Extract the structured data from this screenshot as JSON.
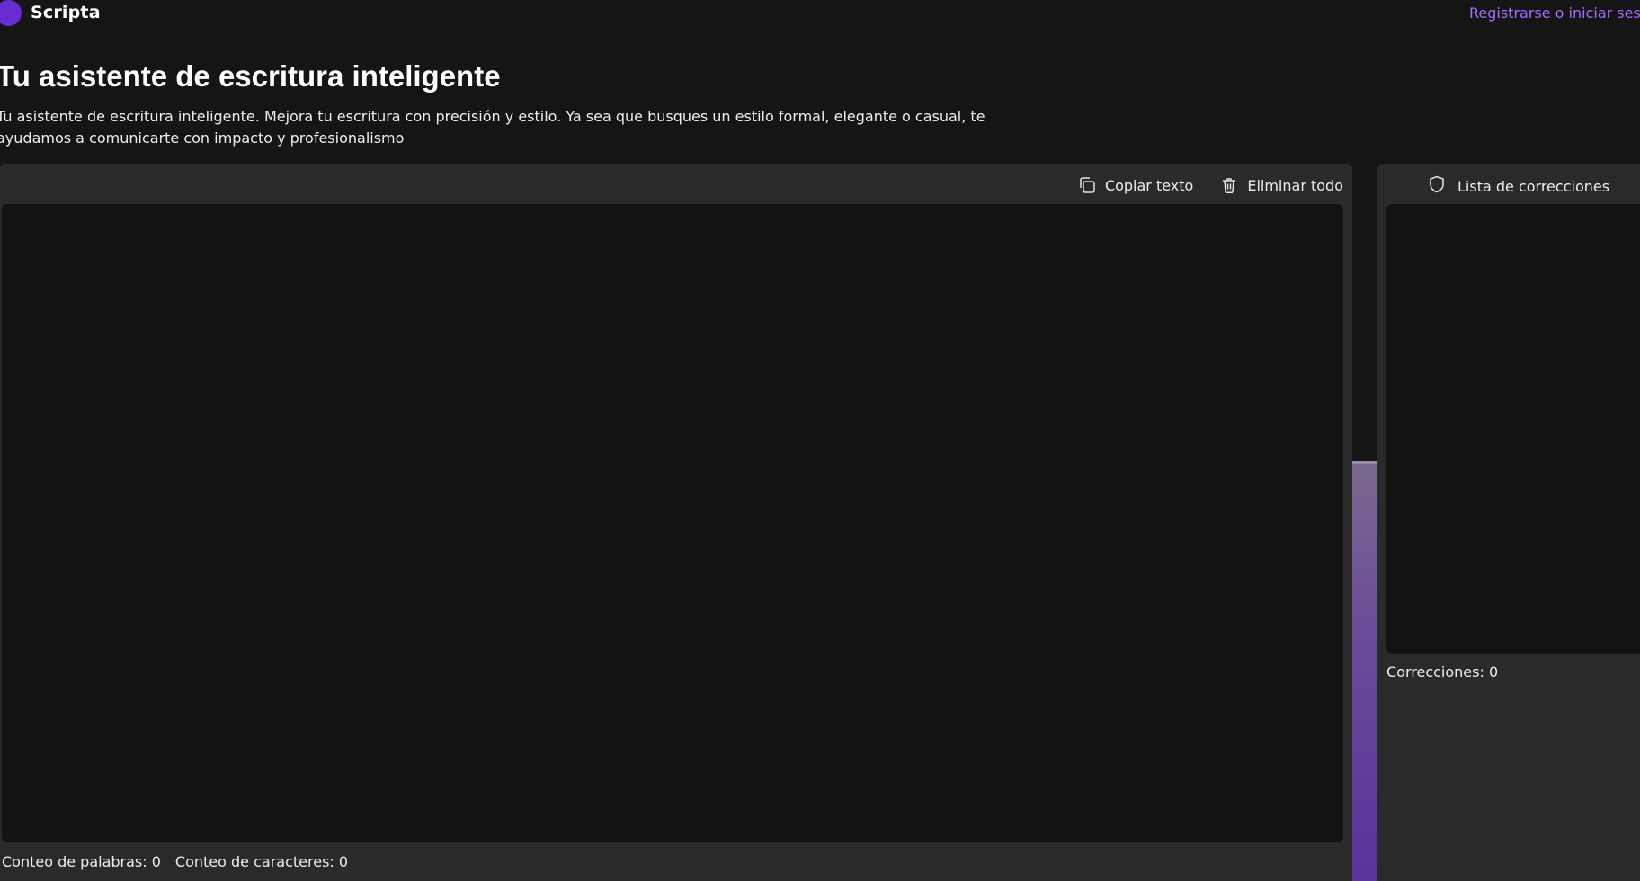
{
  "header": {
    "brand": "Scripta",
    "auth_link": "Registrarse o iniciar sesió"
  },
  "hero": {
    "title": "Tu asistente de escritura inteligente",
    "subtitle": "Tu asistente de escritura inteligente. Mejora tu escritura con precisión y estilo. Ya sea que busques un estilo formal, elegante o casual, te ayudamos a comunicarte con impacto y profesionalismo"
  },
  "editor": {
    "copy_label": "Copiar texto",
    "clear_label": "Eliminar todo",
    "text_value": "",
    "word_count_label": "Conteo de palabras: 0",
    "char_count_label": "Conteo de caracteres: 0"
  },
  "corrections": {
    "header_label": "Lista de correcciones",
    "count_label": "Correcciones: 0"
  },
  "icons": {
    "copy": "copy-icon",
    "delete": "trash-icon",
    "corrections": "shield-icon"
  },
  "colors": {
    "accent": "#6a2bd3",
    "link": "#a66bff",
    "background": "#151515",
    "panel": "#2a2a2a",
    "input": "#131313"
  }
}
